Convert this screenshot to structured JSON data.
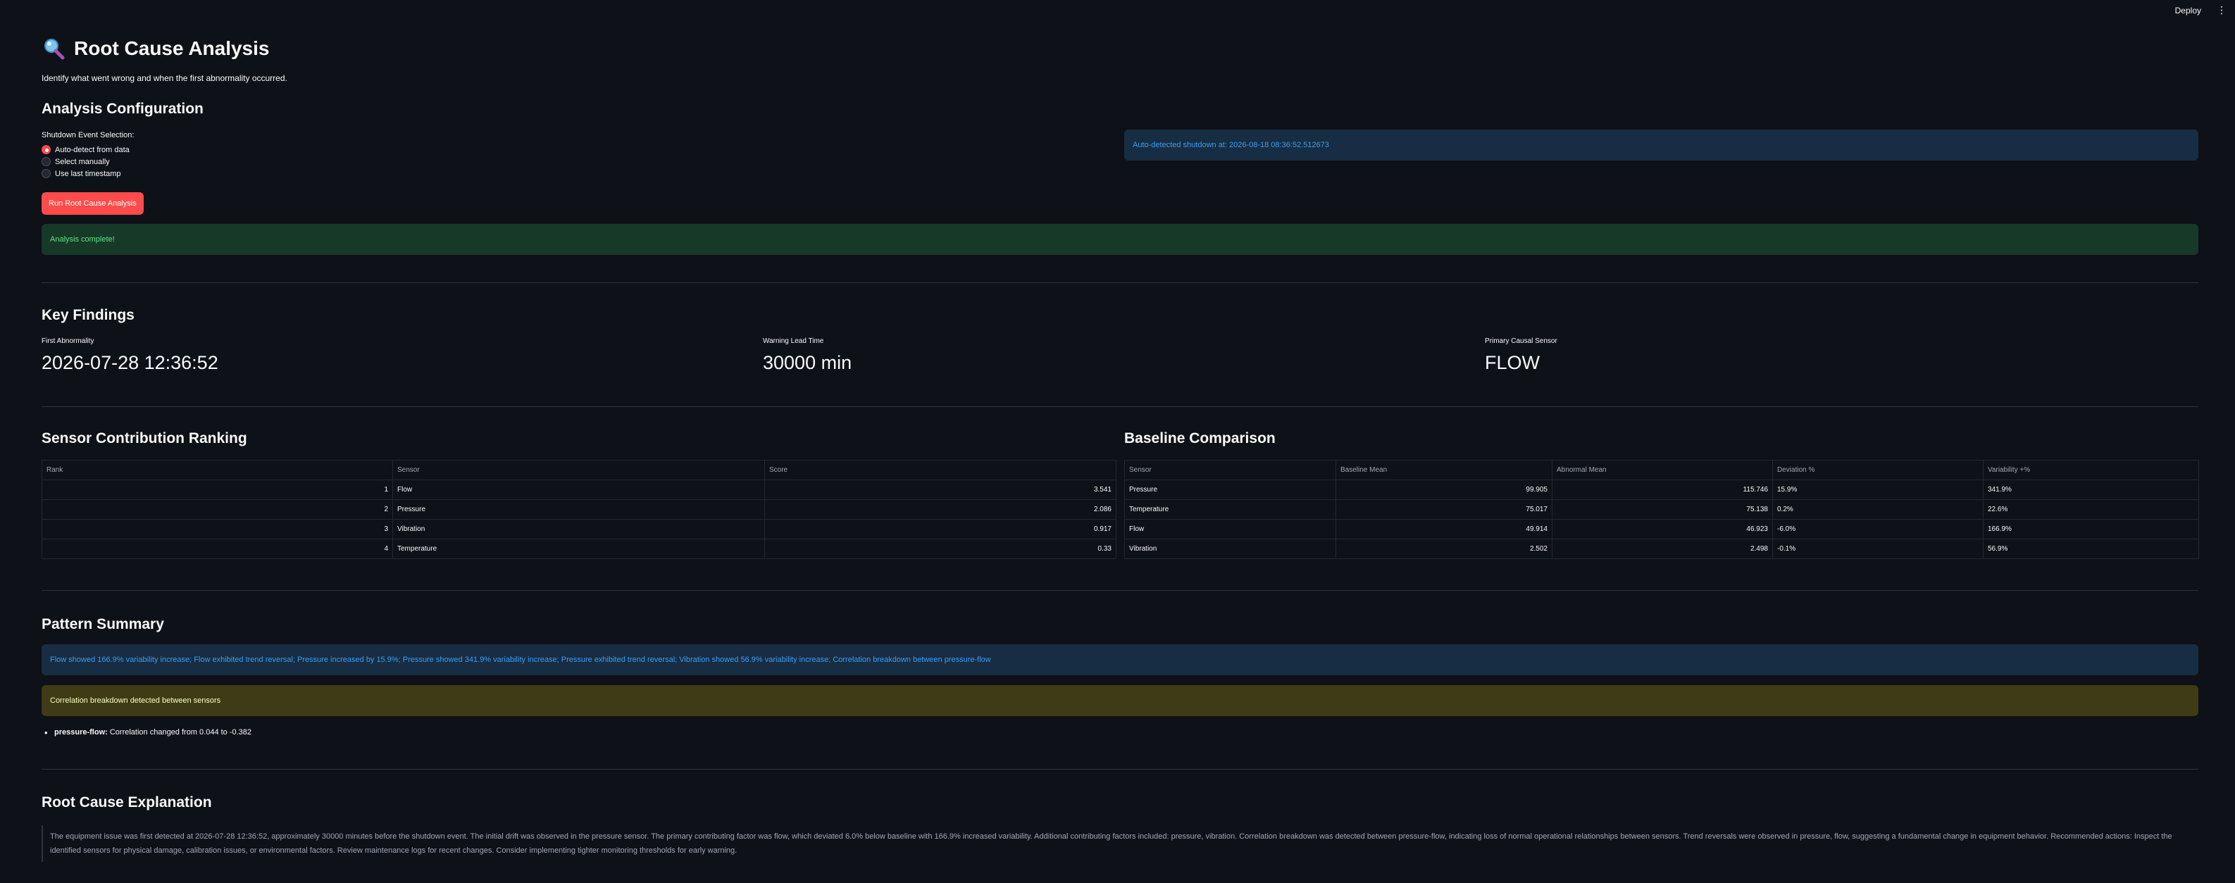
{
  "topbar": {
    "deploy_label": "Deploy",
    "menu_glyph": "⋮"
  },
  "header": {
    "icon": "magnifying-glass-icon",
    "title": "Root Cause Analysis",
    "subtitle": "Identify what went wrong and when the first abnormality occurred."
  },
  "config": {
    "heading": "Analysis Configuration",
    "radio_label": "Shutdown Event Selection:",
    "options": [
      {
        "label": "Auto-detect from data",
        "selected": true
      },
      {
        "label": "Select manually",
        "selected": false
      },
      {
        "label": "Use last timestamp",
        "selected": false
      }
    ],
    "run_button_label": "Run Root Cause Analysis",
    "auto_detect_info": "Auto-detected shutdown at: 2026-08-18 08:36:52.512673",
    "success_message": "Analysis complete!"
  },
  "key_findings": {
    "heading": "Key Findings",
    "metrics": [
      {
        "label": "First Abnormality",
        "value": "2026-07-28 12:36:52"
      },
      {
        "label": "Warning Lead Time",
        "value": "30000 min"
      },
      {
        "label": "Primary Causal Sensor",
        "value": "FLOW"
      }
    ]
  },
  "ranking": {
    "heading": "Sensor Contribution Ranking",
    "columns": [
      "Rank",
      "Sensor",
      "Score"
    ],
    "rows": [
      [
        "1",
        "Flow",
        "3.541"
      ],
      [
        "2",
        "Pressure",
        "2.086"
      ],
      [
        "3",
        "Vibration",
        "0.917"
      ],
      [
        "4",
        "Temperature",
        "0.33"
      ]
    ]
  },
  "baseline": {
    "heading": "Baseline Comparison",
    "columns": [
      "Sensor",
      "Baseline Mean",
      "Abnormal Mean",
      "Deviation %",
      "Variability +%"
    ],
    "rows": [
      [
        "Pressure",
        "99.905",
        "115.746",
        "15.9%",
        "341.9%"
      ],
      [
        "Temperature",
        "75.017",
        "75.138",
        "0.2%",
        "22.6%"
      ],
      [
        "Flow",
        "49.914",
        "46.923",
        "-6.0%",
        "166.9%"
      ],
      [
        "Vibration",
        "2.502",
        "2.498",
        "-0.1%",
        "56.9%"
      ]
    ]
  },
  "pattern": {
    "heading": "Pattern Summary",
    "info": "Flow showed 166.9% variability increase; Flow exhibited trend reversal; Pressure increased by 15.9%; Pressure showed 341.9% variability increase; Pressure exhibited trend reversal; Vibration showed 56.9% variability increase; Correlation breakdown between pressure-flow",
    "warning": "Correlation breakdown detected between sensors",
    "bullet_key": "pressure-flow:",
    "bullet_text": " Correlation changed from 0.044 to -0.382"
  },
  "explanation": {
    "heading": "Root Cause Explanation",
    "text": "The equipment issue was first detected at 2026-07-28 12:36:52, approximately 30000 minutes before the shutdown event. The initial drift was observed in the pressure sensor. The primary contributing factor was flow, which deviated 6.0% below baseline with 166.9% increased variability. Additional contributing factors included: pressure, vibration. Correlation breakdown was detected between pressure-flow, indicating loss of normal operational relationships between sensors. Trend reversals were observed in pressure, flow, suggesting a fundamental change in equipment behavior. Recommended actions: Inspect the identified sensors for physical damage, calibration issues, or environmental factors. Review maintenance logs for recent changes. Consider implementing tighter monitoring thresholds for early warning."
  }
}
